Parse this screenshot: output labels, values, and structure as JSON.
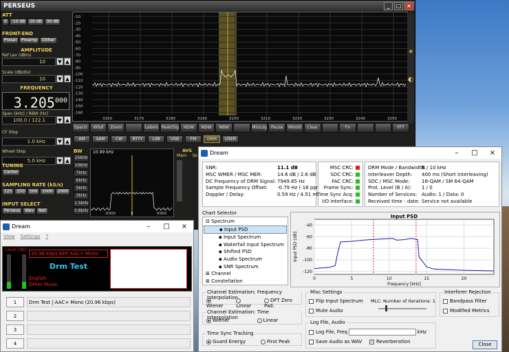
{
  "perseus": {
    "title": "PERSEUS",
    "att": {
      "label": "ATT",
      "buttons": [
        "0",
        ".10 dB",
        "20 dB",
        "30 dB"
      ]
    },
    "frontend": {
      "label": "FRONT-END",
      "buttons": [
        "Presel",
        "Preamp",
        "Dither"
      ]
    },
    "amplitude": "AMPLITUDE",
    "ref_lev_label": "Ref Lev (dBm)",
    "ref_lev": "10",
    "scale_label": "Scale (dB/div)",
    "scale": "10",
    "frequency_label": "FREQUENCY",
    "freq_main": "3.205",
    "freq_small": "000",
    "span_label": "Span (kHz) / RBW (Hz)",
    "span": "100.0 / 122.1",
    "cfstep_label": "CF Step",
    "cfstep": "1.0 kHz",
    "wheel_label": "Wheel Step",
    "wheel": "5.0 kHz",
    "tuning": "TUNING",
    "tuning_btn": "Center",
    "sampling": "SAMPLING RATE (kS/s)",
    "sampling_btns": [
      "125",
      "250",
      "500",
      "1000",
      "2000"
    ],
    "input": "INPUT SELECT",
    "input_btns": [
      "Perseus",
      "Wav",
      "Net"
    ],
    "yticks": [
      "-10",
      "-20",
      "-30",
      "-40",
      "-50",
      "-60",
      "-70",
      "-80",
      "-90",
      "-100",
      "-110",
      "-120",
      "-130",
      "-140",
      "-150",
      "-160"
    ],
    "xticks": [
      "3160",
      "3170",
      "3180",
      "3190",
      "3200",
      "3210",
      "3220",
      "3230",
      "3240",
      "3250"
    ],
    "toolbar": [
      "Spectr",
      "Wfall",
      "Zoom",
      "",
      "Labels",
      "Peak/Sig",
      "NDW",
      "NDW",
      "NBW",
      "",
      "MinLog",
      "Pause",
      "MHold",
      "Clear",
      "",
      "Fn",
      "",
      "",
      "FFT"
    ],
    "modes": [
      "AM",
      "SAM",
      "CW",
      "RTTY",
      "LSB",
      "USB",
      "FM",
      "DRM",
      "USER"
    ],
    "bw_label": "BW",
    "bw": [
      "25kHz",
      "10kHz",
      "7kHz",
      "6kHz",
      "5kHz",
      "3kHz",
      "1.5kHz",
      "0.8kHz"
    ],
    "small_label": "10.99 kHz",
    "small_ticks": [
      "-5000",
      "0",
      "5000"
    ],
    "avg": "AVG",
    "avg_main": "Main",
    "avg_sec": "Se"
  },
  "dream": {
    "title": "Dream",
    "status": [
      [
        "SNR:",
        "11.1 dB"
      ],
      [
        "MSC WMER / MSC MER:",
        "14.6 dB / 2.6 dB"
      ],
      [
        "DC Frequency of DRM Signal:",
        "7949.85 Hz"
      ],
      [
        "Sample Frequency Offset:",
        "-0.79 Hz (-16 ppm)"
      ],
      [
        "Doppler / Delay:",
        "0.59 Hz / 4.51 ms"
      ]
    ],
    "crc": [
      "MSC CRC:",
      "SDC CRC:",
      "FAC CRC:",
      "Frame Sync:",
      "Time Sync Acq:",
      "I/O Interface:"
    ],
    "crc_colors": [
      "#e02020",
      "#20c020",
      "#20c020",
      "#20c020",
      "#20c020",
      "#20c020"
    ],
    "mode": [
      [
        "DRM Mode / Bandwidth:",
        "B / 10 kHz"
      ],
      [
        "Interleaver Depth:",
        "400 ms (Short Interleaving)"
      ],
      [
        "SDC / MSC Mode:",
        "16-QAM / SM 64-QAM"
      ],
      [
        "Prot. Level (B / A):",
        "1 / 0"
      ],
      [
        "Number of Services:",
        "Audio: 1 / Data: 0"
      ],
      [
        "Received time - date:",
        "Service not available"
      ]
    ],
    "chart_selector": "Chart Selector",
    "tree": [
      "Spectrum",
      "Input PSD",
      "Input Spectrum",
      "Waterfall Input Spectrum",
      "Shifted PSD",
      "Audio Spectrum",
      "SNR Spectrum",
      "Channel",
      "Constellation"
    ],
    "chart_data": {
      "type": "line",
      "title": "Input PSD",
      "xlabel": "Frequency [kHz]",
      "ylabel": "Input PSD [dB]",
      "xticks": [
        "0",
        "5",
        "10",
        "15",
        "20"
      ],
      "yticks": [
        "-40",
        "-60",
        "-80",
        "-100",
        "-120"
      ],
      "xlim": [
        0,
        24
      ],
      "ylim": [
        -125,
        -30
      ],
      "series": [
        {
          "x": [
            0,
            1,
            2,
            2.8,
            3,
            3.5,
            5,
            6.5,
            7.5,
            9,
            10.5,
            11,
            12,
            13,
            13.8,
            14,
            15,
            16,
            20,
            24
          ],
          "y": [
            -115,
            -114,
            -113,
            -110,
            -95,
            -69,
            -68,
            -66,
            -65,
            -64,
            -63,
            -66,
            -65,
            -63,
            -65,
            -95,
            -112,
            -116,
            -118,
            -119
          ]
        }
      ],
      "marker_x": [
        7.9,
        13.6
      ]
    },
    "freq_interp": {
      "label": "Channel Estimation: Frequency Interpolation",
      "opts": [
        "Wiener",
        "Linear",
        "DFT Zero Pad."
      ]
    },
    "time_interp": {
      "label": "Channel Estimation: Time Interpolation",
      "opts": [
        "Wiener",
        "Linear"
      ]
    },
    "time_sync": {
      "label": "Time Sync Tracking",
      "opts": [
        "Guard Energy",
        "First Peak"
      ]
    },
    "misc": {
      "label": "Misc Settings",
      "flip": "Flip Input Spectrum",
      "mute": "Mute Audio",
      "mlc": "MLC: Number of Iterations: 1"
    },
    "log": {
      "label": "Log File, Audio",
      "logfreq": "Log File, Freq",
      "khz": "kHz",
      "wav": "Save Audio as WAV",
      "reverb": "Reverberation"
    },
    "interf": {
      "label": "Interferer Rejection",
      "bandpass": "Bandpass Filter",
      "modified": "Modified Metrics"
    },
    "close": "Close"
  },
  "dream2": {
    "title": "Dream",
    "menu": [
      "View",
      "Settings",
      "?"
    ],
    "level": "Level [dB]",
    "bitrate": "20.96 kbps EEP  AAC+ Mono",
    "station": "Drm Test",
    "lang": "English",
    "genre": "Other Music",
    "services": [
      {
        "n": "1",
        "t": "Drm Test  |  AAC+ Mono (20.96 kbps)"
      },
      {
        "n": "2",
        "t": ""
      },
      {
        "n": "3",
        "t": ""
      },
      {
        "n": "4",
        "t": ""
      }
    ]
  }
}
